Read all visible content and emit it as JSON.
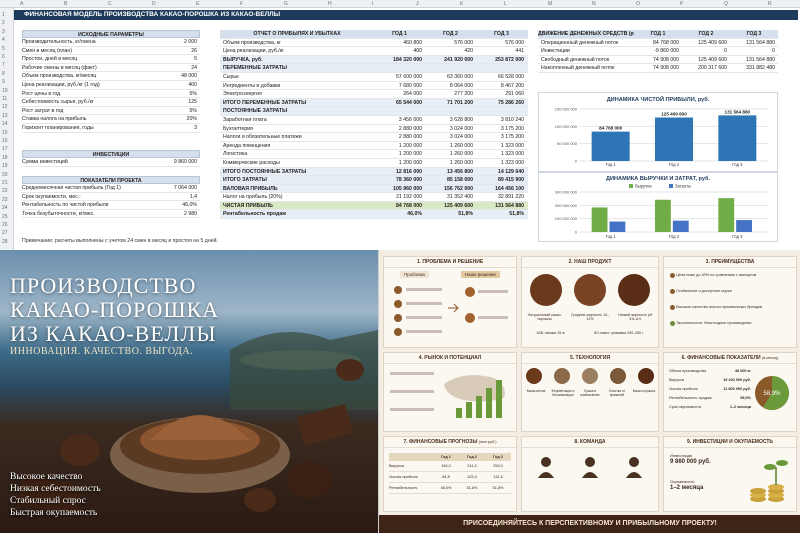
{
  "sheet": {
    "title": "ФИНАНСОВАЯ МОДЕЛЬ ПРОИЗВОДСТВА КАКАО-ПОРОШКА ИЗ КАКАО-ВЕЛЛЫ",
    "col_letters": [
      "A",
      "B",
      "C",
      "D",
      "E",
      "F",
      "G",
      "H",
      "I",
      "J",
      "K",
      "L",
      "M",
      "N",
      "O",
      "P",
      "Q",
      "R"
    ],
    "row_numbers": [
      "1",
      "2",
      "3",
      "4",
      "5",
      "6",
      "7",
      "8",
      "9",
      "10",
      "11",
      "12",
      "13",
      "14",
      "15",
      "16",
      "17",
      "18",
      "19",
      "20",
      "21",
      "22",
      "23",
      "24",
      "25",
      "26",
      "27",
      "28"
    ],
    "params": {
      "header": "ИСХОДНЫЕ ПАРАМЕТРЫ",
      "rows": [
        [
          "Производительность, кг/смена",
          "2 000"
        ],
        [
          "Смен в месяц (план)",
          "26"
        ],
        [
          "Простои, дней в месяц",
          "5"
        ],
        [
          "Рабочие смены в месяц (факт)",
          "24"
        ],
        [
          "Объем производства, кг/месяц",
          "48 000"
        ],
        [
          "Цена реализации, руб./кг (1 год)",
          "400"
        ],
        [
          "Рост цены в год",
          "5%"
        ],
        [
          "Себестоимость сырья, руб./кг",
          "125"
        ],
        [
          "Рост затрат в год",
          "5%"
        ],
        [
          "Ставка налога на прибыль",
          "20%"
        ],
        [
          "Горизонт планирования, годы",
          "3"
        ]
      ]
    },
    "invest": {
      "header": "ИНВЕСТИЦИИ",
      "rows": [
        [
          "Сумма инвестиций",
          "9 860 000"
        ]
      ]
    },
    "kpi": {
      "header": "ПОКАЗАТЕЛИ ПРОЕКТА",
      "rows": [
        [
          "Среднемесячная чистая прибыль (Год 1)",
          "7 064 000"
        ],
        [
          "Срок окупаемости, мес.:",
          "1,4"
        ],
        [
          "Рентабельность по чистой прибыли",
          "46,0%"
        ],
        [
          "Точка безубыточности, кг/мес.",
          "2 980"
        ]
      ]
    },
    "pnl": {
      "header": "ОТЧЕТ О ПРИБЫЛЯХ И УБЫТКАХ",
      "cols": [
        "ГОД 1",
        "ГОД 2",
        "ГОД 3"
      ],
      "rows": [
        [
          "Объем производства, кг",
          "460 800",
          "576 000",
          "576 000",
          ""
        ],
        [
          "Цена реализации, руб./кг",
          "400",
          "420",
          "441",
          ""
        ],
        [
          "ВЫРУЧКА, руб.",
          "184 320 000",
          "241 920 000",
          "253 872 000",
          "b"
        ],
        [
          "ПЕРЕМЕННЫЕ ЗАТРАТЫ",
          "",
          "",
          "",
          "s"
        ],
        [
          "Сырье",
          "57 600 000",
          "63 360 000",
          "66 528 000",
          ""
        ],
        [
          "Ингредиенты и добавки",
          "7 680 000",
          "8 064 000",
          "8 467 200",
          ""
        ],
        [
          "Электроэнергия",
          "264 000",
          "277 200",
          "291 060",
          ""
        ],
        [
          "ИТОГО ПЕРЕМЕННЫЕ ЗАТРАТЫ",
          "65 544 000",
          "71 701 200",
          "75 286 260",
          "b"
        ],
        [
          "ПОСТОЯННЫЕ ЗАТРАТЫ",
          "",
          "",
          "",
          "s"
        ],
        [
          "Заработная плата",
          "3 456 000",
          "3 628 800",
          "3 810 240",
          ""
        ],
        [
          "Бухгалтерия",
          "2 880 000",
          "3 024 000",
          "3 175 200",
          ""
        ],
        [
          "Налоги и обязательные платежи",
          "2 880 000",
          "3 024 000",
          "3 175 200",
          ""
        ],
        [
          "Аренда помещения",
          "1 200 000",
          "1 260 000",
          "1 323 000",
          ""
        ],
        [
          "Логистика",
          "1 200 000",
          "1 260 000",
          "1 323 000",
          ""
        ],
        [
          "Коммерческие расходы",
          "1 200 000",
          "1 260 000",
          "1 323 000",
          ""
        ],
        [
          "ИТОГО ПОСТОЯННЫЕ ЗАТРАТЫ",
          "12 816 000",
          "13 456 800",
          "14 129 640",
          "b"
        ],
        [
          "ИТОГО ЗАТРАТЫ",
          "78 360 000",
          "85 158 000",
          "89 415 900",
          "b"
        ],
        [
          "ВАЛОВАЯ ПРИБЫЛЬ",
          "105 960 000",
          "156 762 000",
          "164 456 100",
          "b"
        ],
        [
          "Налог на прибыль (20%)",
          "21 192 000",
          "31 352 400",
          "32 891 220",
          ""
        ],
        [
          "ЧИСТАЯ ПРИБЫЛЬ",
          "84 768 000",
          "125 409 600",
          "131 564 880",
          "g"
        ],
        [
          "Рентабельность продаж",
          "46,0%",
          "51,8%",
          "51,8%",
          "b"
        ]
      ]
    },
    "cash": {
      "header": "ДВИЖЕНИЕ ДЕНЕЖНЫХ СРЕДСТВ (руб.)",
      "cols": [
        "ГОД 1",
        "ГОД 2",
        "ГОД 3"
      ],
      "rows": [
        [
          "Операционный денежный поток",
          "84 768 000",
          "125 409 600",
          "131 564 880"
        ],
        [
          "Инвестиции",
          "-9 860 000",
          "0",
          "0"
        ],
        [
          "Свободный денежный поток",
          "74 908 000",
          "125 409 600",
          "131 564 880"
        ],
        [
          "Накопленный денежный поток",
          "74 908 000",
          "200 317 600",
          "331 882 480"
        ]
      ]
    },
    "note": "Примечание: расчеты выполнены с учетом 24 смен в месяц и простоя на 5 дней."
  },
  "chart_data": [
    {
      "type": "bar",
      "title": "ДИНАМИКА ЧИСТОЙ ПРИБЫЛИ, руб.",
      "categories": [
        "Год 1",
        "Год 2",
        "Год 3"
      ],
      "values": [
        84768000,
        125409600,
        131564880
      ],
      "data_labels": [
        "84 768 000",
        "125 409 600",
        "131 564 880"
      ],
      "ylim": [
        0,
        150000000
      ],
      "yticks": [
        "150 000 000",
        "100 000 000",
        "50 000 000",
        "0"
      ],
      "color": "#2e75b6"
    },
    {
      "type": "bar",
      "title": "ДИНАМИКА ВЫРУЧКИ И ЗАТРАТ, руб.",
      "categories": [
        "Год 1",
        "Год 2",
        "Год 3"
      ],
      "series": [
        {
          "name": "Выручка",
          "values": [
            184320000,
            241920000,
            253872000
          ],
          "color": "#70ad47"
        },
        {
          "name": "Затраты",
          "values": [
            78360000,
            85158000,
            89415900
          ],
          "color": "#4472c4"
        }
      ],
      "ylim": [
        0,
        300000000
      ],
      "yticks": [
        "300 000 000",
        "200 000 000",
        "100 000 000",
        "0"
      ],
      "legend": "top"
    }
  ],
  "poster": {
    "title_lines": [
      "ПРОИЗВОДСТВО",
      "КАКАО-ПОРОШКА",
      "ИЗ КАКАО-ВЕЛЛЫ"
    ],
    "subtitle": "ИННОВАЦИЯ. КАЧЕСТВО. ВЫГОДА.",
    "bullets": [
      "Высокое качество",
      "Низкая себестоимость",
      "Стабильный спрос",
      "Быстрая окупаемость"
    ]
  },
  "infographic": {
    "p1": "1. ПРОБЛЕМА И РЕШЕНИЕ",
    "p1_problem": "Проблема",
    "p1_solution": "Наше решение",
    "p2": "2. НАШ ПРОДУКТ",
    "p2_items": [
      "Натуральный какао-порошок",
      "Средняя жирность 10–12%",
      "Низкий жирность рН 5,6–6,0"
    ],
    "p2_pack": [
      "КЗБ: мешки 25 кг",
      "КО-пакет: упаковка 200–250 г"
    ],
    "p3": "3. ПРЕИМУЩЕСТВА",
    "p3_items": [
      "Цена ниже до 40% по сравнению с импортом",
      "Стабильное и доступное сырье",
      "Высокое качество аналог премиальных брендов",
      "Экологичность: безотходное производство"
    ],
    "p4": "4. РЫНОК И ПОТЕНЦИАЛ",
    "p5": "5. ТЕХНОЛОГИЯ",
    "p5_steps": [
      "Какао-велла",
      "Ферментация и биохимизация",
      "Сушка и измельчение",
      "Очистка от примесей",
      "Какао-порошок"
    ],
    "p6": "6. ФИНАНСОВЫЕ ПОКАЗАТЕЛИ",
    "p6_unit": "(в месяц)",
    "p6_rows": [
      [
        "Объем производства",
        "48 000 кг"
      ],
      [
        "Выручка",
        "19 200 000 руб."
      ],
      [
        "Чистая прибыль",
        "11 800 000 руб."
      ],
      [
        "Рентабельность продаж",
        "58,9%"
      ],
      [
        "Срок окупаемости",
        "1–2 месяца"
      ]
    ],
    "p6_pie": "58,9%",
    "p7": "7. ФИНАНСОВЫЕ ПРОГНОЗЫ",
    "p7_unit": "(млн руб.)",
    "p7_cols": [
      "Год 1",
      "Год 2",
      "Год 3"
    ],
    "p7_rows": [
      [
        "Выручка",
        "184,3",
        "241,9",
        "254,0"
      ],
      [
        "Чистая прибыль",
        "84,8",
        "125,4",
        "131,6"
      ],
      [
        "Рентабельность",
        "46,0%",
        "51,8%",
        "51,8%"
      ]
    ],
    "p8": "8. КОМАНДА",
    "p9": "9. ИНВЕСТИЦИИ И ОКУПАЕМОСТЬ",
    "p9_inv_label": "Инвестиции",
    "p9_inv": "9 860 000 руб.",
    "p9_pay_label": "Окупаемость",
    "p9_pay": "1–2 месяца",
    "footer": "ПРИСОЕДИНЯЙТЕСЬ К ПЕРСПЕКТИВНОМУ И ПРИБЫЛЬНОМУ ПРОЕКТУ!"
  }
}
